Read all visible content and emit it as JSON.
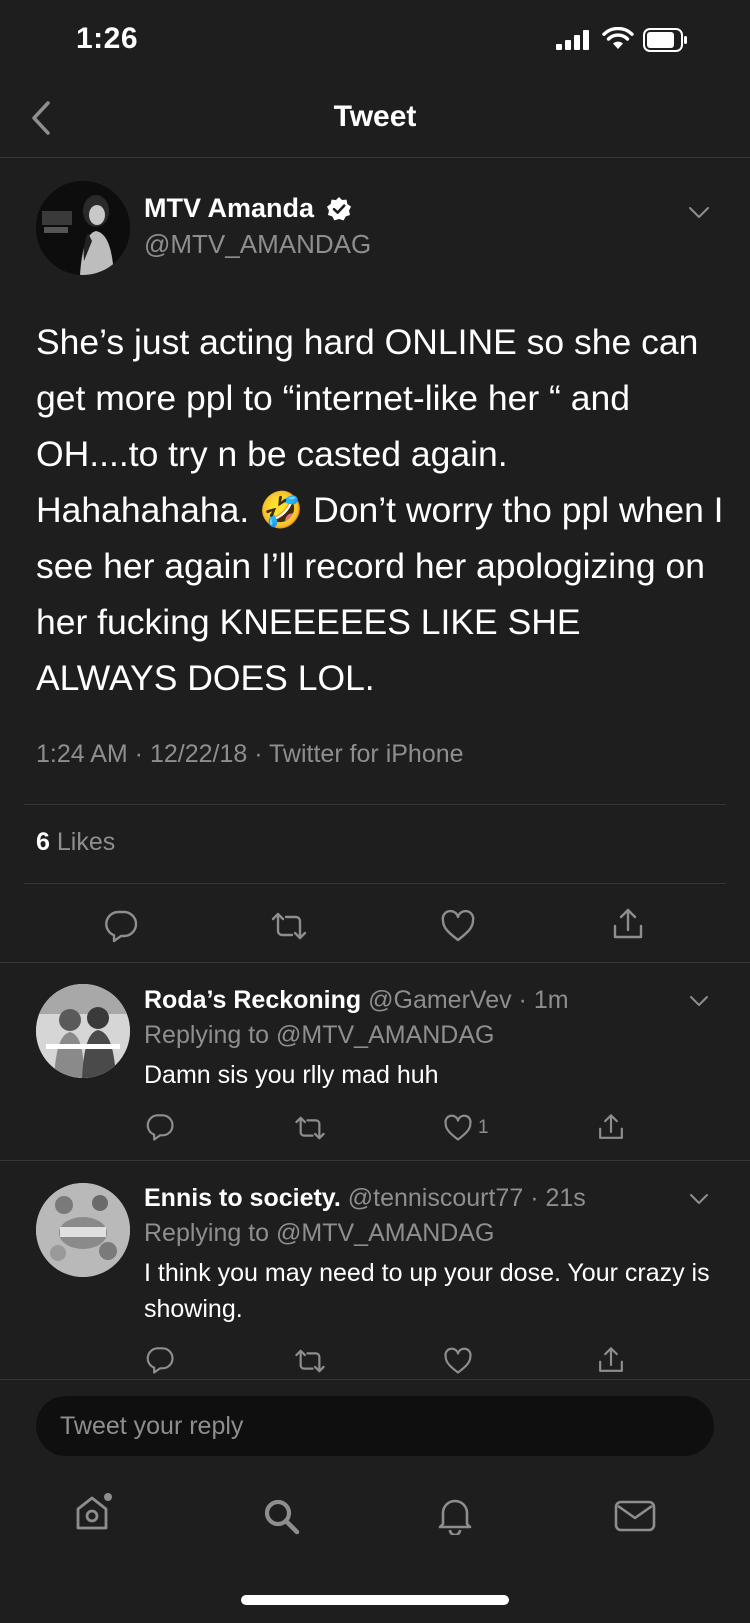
{
  "status_bar": {
    "time": "1:26"
  },
  "header": {
    "title": "Tweet"
  },
  "tweet": {
    "author_name": "MTV Amanda",
    "author_handle": "@MTV_AMANDAG",
    "text": "She’s just acting hard ONLINE so she can get more ppl to “internet-like her “ and OH....to try n be casted again. Hahahahaha. 🤣 Don’t worry tho ppl when I see her again I’ll record her apologizing on her fucking KNEEEEES LIKE SHE ALWAYS DOES LOL.",
    "meta": "1:24 AM · 12/22/18 · Twitter for iPhone",
    "likes_count": "6",
    "likes_label": "Likes"
  },
  "replies": [
    {
      "name": "Roda’s Reckoning",
      "handle": "@GamerVev · 1m",
      "replying_to": "Replying to @MTV_AMANDAG",
      "text": "Damn sis you rlly mad huh",
      "like_count": "1"
    },
    {
      "name": "Ennis to society.",
      "handle": "@tenniscourt77 · 21s",
      "replying_to": "Replying to @MTV_AMANDAG",
      "text": "I think you may need to up your dose. Your crazy is showing.",
      "like_count": ""
    }
  ],
  "composer": {
    "placeholder": "Tweet your reply"
  },
  "tab_bar": {
    "items": [
      "home-icon",
      "search-icon",
      "notifications-icon",
      "messages-icon"
    ]
  },
  "colors": {
    "background": "#1e1e1e",
    "secondary_text": "#8e8e8e",
    "separator": "#363636"
  }
}
